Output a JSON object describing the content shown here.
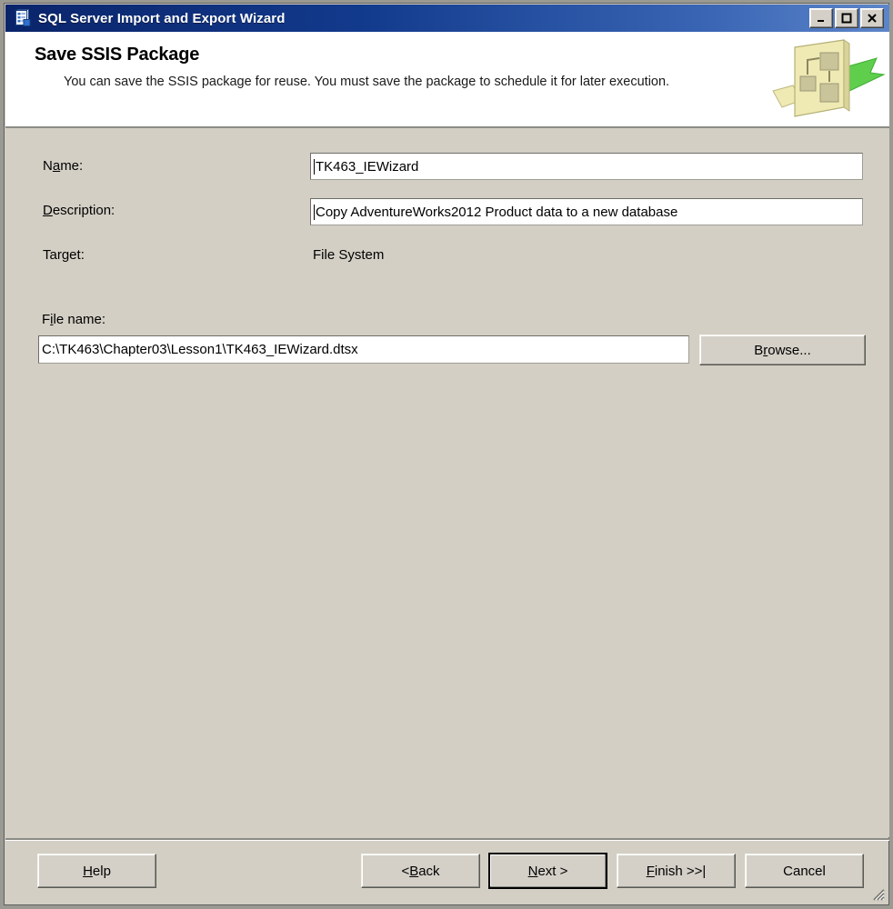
{
  "window": {
    "title": "SQL Server Import and Export Wizard",
    "icon": "wizard-document-icon",
    "controls": {
      "minimize": "_",
      "maximize": "□",
      "close": "✕"
    }
  },
  "header": {
    "title": "Save SSIS Package",
    "description": "You can save the SSIS package for reuse. You must save the package to schedule it for later execution.",
    "art": "ssis-package-arrow-graphic"
  },
  "form": {
    "name": {
      "label_pre": "N",
      "label_accel": "a",
      "label_post": "me:",
      "value": "TK463_IEWizard"
    },
    "description": {
      "label_pre": "",
      "label_accel": "D",
      "label_post": "escription:",
      "value": "Copy AdventureWorks2012 Product data to a new database"
    },
    "target": {
      "label": "Target:",
      "value": "File System"
    },
    "filename": {
      "label_pre": "F",
      "label_accel": "i",
      "label_post": "le name:",
      "value": "C:\\TK463\\Chapter03\\Lesson1\\TK463_IEWizard.dtsx"
    },
    "browse": {
      "label_pre": "B",
      "label_accel": "r",
      "label_post": "owse..."
    }
  },
  "footer": {
    "help": {
      "pre": "",
      "accel": "H",
      "post": "elp"
    },
    "back": {
      "pre": "< ",
      "accel": "B",
      "post": "ack"
    },
    "next": {
      "pre": "",
      "accel": "N",
      "post": "ext >"
    },
    "finish": {
      "pre": "",
      "accel": "F",
      "post": "inish >>|"
    },
    "cancel": {
      "pre": "Cancel",
      "accel": "",
      "post": ""
    }
  },
  "colors": {
    "titlebar_start": "#0a246a",
    "titlebar_end": "#5d85c9",
    "dialog_bg": "#d3cfc5",
    "header_bg": "#ffffff",
    "field_bg": "#ffffff",
    "art_yellow": "#e8e3a8",
    "art_green": "#66cc55"
  }
}
